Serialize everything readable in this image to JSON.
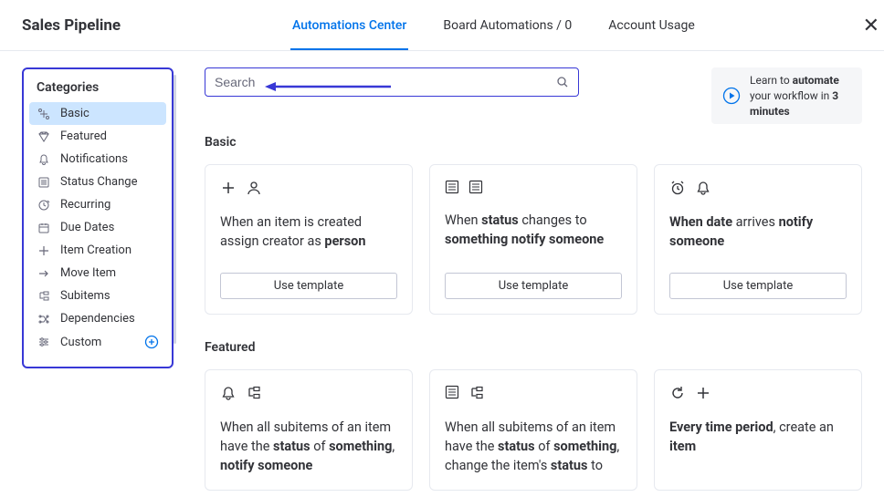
{
  "header": {
    "title": "Sales Pipeline",
    "tabs": [
      {
        "label": "Automations Center",
        "active": true
      },
      {
        "label": "Board Automations / 0",
        "active": false
      },
      {
        "label": "Account Usage",
        "active": false
      }
    ]
  },
  "sidebar": {
    "title": "Categories",
    "items": [
      {
        "label": "Basic",
        "icon": "basic-icon",
        "active": true
      },
      {
        "label": "Featured",
        "icon": "diamond-icon",
        "active": false
      },
      {
        "label": "Notifications",
        "icon": "bell-icon",
        "active": false
      },
      {
        "label": "Status Change",
        "icon": "list-icon",
        "active": false
      },
      {
        "label": "Recurring",
        "icon": "clock-icon",
        "active": false
      },
      {
        "label": "Due Dates",
        "icon": "calendar-icon",
        "active": false
      },
      {
        "label": "Item Creation",
        "icon": "plus-icon",
        "active": false
      },
      {
        "label": "Move Item",
        "icon": "arrow-right-icon",
        "active": false
      },
      {
        "label": "Subitems",
        "icon": "subitems-icon",
        "active": false
      },
      {
        "label": "Dependencies",
        "icon": "dependencies-icon",
        "active": false
      },
      {
        "label": "Custom",
        "icon": "settings-icon",
        "active": false
      }
    ]
  },
  "search": {
    "placeholder": "Search"
  },
  "learn": {
    "text_pre": "Learn to ",
    "bold1": "automate",
    "text_mid": " your workflow in ",
    "bold2": "3 minutes"
  },
  "sections": {
    "basic": {
      "title": "Basic",
      "cards": [
        {
          "icons": [
            "plus-icon",
            "person-icon"
          ],
          "html": "When an item is created assign creator as <strong>person</strong>",
          "btn": "Use template"
        },
        {
          "icons": [
            "list-icon",
            "list-icon"
          ],
          "html": "When <strong>status</strong> changes to <strong>something notify someone</strong>",
          "btn": "Use template"
        },
        {
          "icons": [
            "alarm-icon",
            "bell-icon"
          ],
          "html": "<strong>When date</strong> arrives <strong>notify someone</strong>",
          "btn": "Use template"
        }
      ]
    },
    "featured": {
      "title": "Featured",
      "cards": [
        {
          "icons": [
            "bell-icon",
            "subitems-icon"
          ],
          "html": "When all subitems of an item have the <strong>status</strong> of <strong>something</strong>, <strong>notify someone</strong>"
        },
        {
          "icons": [
            "list-icon",
            "subitems-icon"
          ],
          "html": "When all subitems of an item have the <strong>status</strong> of <strong>something</strong>, change the item's <strong>status</strong> to"
        },
        {
          "icons": [
            "recurring-icon",
            "plus-icon"
          ],
          "html": "<strong>Every time period</strong>, create an <strong>item</strong>"
        }
      ]
    }
  }
}
